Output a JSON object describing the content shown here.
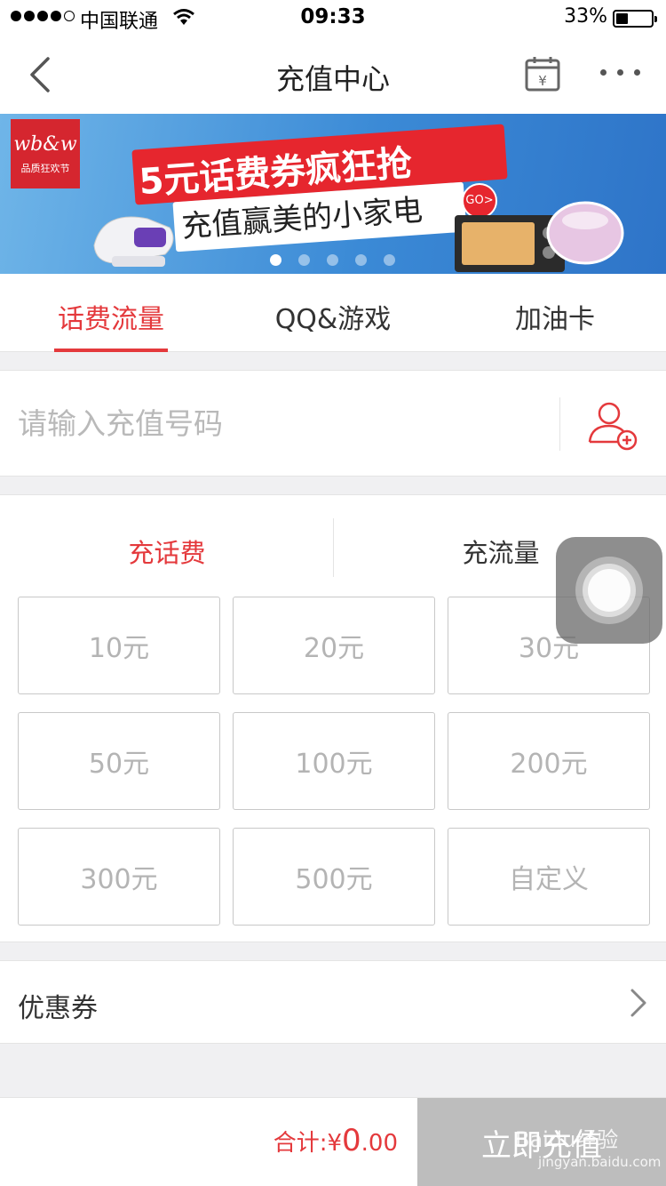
{
  "status_bar": {
    "carrier": "中国联通",
    "time": "09:33",
    "battery": "33%",
    "battery_level": 0.33
  },
  "nav": {
    "title": "充值中心",
    "calendar_glyph": "¥"
  },
  "banner": {
    "logo_text": "wb&w",
    "logo_sub": "品质狂欢节",
    "headline": "5元话费券疯狂抢",
    "subline": "充值赢美的小家电",
    "go_label": "GO>",
    "slide_count": 5,
    "active_slide": 1
  },
  "tabs": [
    {
      "label": "话费流量",
      "active": true
    },
    {
      "label": "QQ&游戏",
      "active": false
    },
    {
      "label": "加油卡",
      "active": false
    }
  ],
  "phone_input": {
    "placeholder": "请输入充值号码",
    "value": ""
  },
  "recharge_type": {
    "options": [
      {
        "label": "充话费",
        "active": true
      },
      {
        "label": "充流量",
        "active": false
      }
    ]
  },
  "amounts": [
    "10元",
    "20元",
    "30元",
    "50元",
    "100元",
    "200元",
    "300元",
    "500元",
    "自定义"
  ],
  "coupon": {
    "label": "优惠券"
  },
  "bottom": {
    "total_label": "合计:",
    "currency": "¥",
    "amount_int": "0",
    "amount_dec": ".00",
    "pay_label": "立即充值"
  },
  "watermark": {
    "text": "Baidu经验",
    "sub": "jingyan.baidu.com"
  },
  "colors": {
    "accent": "#e4393c",
    "disabled_button": "#bdbdbd"
  }
}
